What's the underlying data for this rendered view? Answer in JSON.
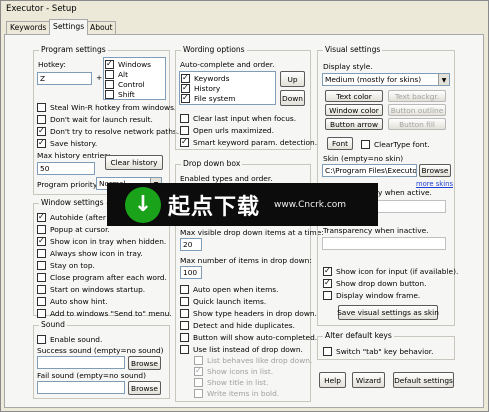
{
  "window": {
    "title": "Executor - Setup"
  },
  "tabs": [
    {
      "label": "Keywords"
    },
    {
      "label": "Settings"
    },
    {
      "label": "About"
    }
  ],
  "program_settings": {
    "title": "Program settings",
    "hotkey_label": "Hotkey:",
    "hotkey_value": "Z",
    "plus": "+",
    "modifiers": [
      {
        "label": "Windows",
        "checked": true
      },
      {
        "label": "Alt",
        "checked": false
      },
      {
        "label": "Control",
        "checked": false
      },
      {
        "label": "Shift",
        "checked": false
      }
    ],
    "options": [
      {
        "label": "Steal Win-R hotkey from windows.",
        "checked": false
      },
      {
        "label": "Don't wait for launch result.",
        "checked": false
      },
      {
        "label": "Don't try to resolve network paths.",
        "checked": true
      },
      {
        "label": "Save history.",
        "checked": true
      }
    ],
    "max_history_label": "Max history entries:",
    "max_history_value": "50",
    "clear_history": "Clear history",
    "priority_label": "Program priority",
    "priority_value": "Normal"
  },
  "window_settings": {
    "title": "Window settings",
    "options": [
      {
        "label": "Autohide (after word a",
        "checked": true
      },
      {
        "label": "Popup at cursor.",
        "checked": false
      },
      {
        "label": "Show icon in tray when hidden.",
        "checked": true
      },
      {
        "label": "Always show icon in tray.",
        "checked": false
      },
      {
        "label": "Stay on top.",
        "checked": false
      },
      {
        "label": "Close program after each word.",
        "checked": false
      },
      {
        "label": "Start on windows startup.",
        "checked": false
      },
      {
        "label": "Auto show hint.",
        "checked": false
      },
      {
        "label": "Add to windows \"Send to\" menu.",
        "checked": false
      }
    ]
  },
  "sound": {
    "title": "Sound",
    "enable_label": "Enable sound.",
    "success_label": "Success sound (empty=no sound)",
    "fail_label": "Fail sound (empty=no sound)",
    "browse": "Browse"
  },
  "wording": {
    "title": "Wording options",
    "autocomplete_label": "Auto-complete and order.",
    "items": [
      {
        "label": "Keywords",
        "checked": true
      },
      {
        "label": "History",
        "checked": true
      },
      {
        "label": "File system",
        "checked": true
      }
    ],
    "up": "Up",
    "down": "Down",
    "options": [
      {
        "label": "Clear last input when focus.",
        "checked": false
      },
      {
        "label": "Open urls maximized.",
        "checked": false
      },
      {
        "label": "Smart keyword param. detection.",
        "checked": true
      }
    ]
  },
  "dropdown": {
    "title": "Drop down box",
    "enabled_label": "Enabled types and order.",
    "max_visible_label": "Max visible drop down items at a time:",
    "max_visible_value": "20",
    "max_items_label": "Max number of items in drop down:",
    "max_items_value": "100",
    "options": [
      {
        "label": "Auto open when items.",
        "checked": false,
        "dim": false
      },
      {
        "label": "Quick launch items.",
        "checked": false,
        "dim": false
      },
      {
        "label": "Show type headers in drop down.",
        "checked": false,
        "dim": false
      },
      {
        "label": "Detect and hide duplicates.",
        "checked": false,
        "dim": false
      },
      {
        "label": "Button will show auto-completed.",
        "checked": false,
        "dim": false
      },
      {
        "label": "Use list instead of drop down.",
        "checked": false,
        "dim": false
      },
      {
        "label": "List behaves like drop down.",
        "checked": false,
        "dim": true
      },
      {
        "label": "Show icons in list.",
        "checked": true,
        "dim": true
      },
      {
        "label": "Show title in list.",
        "checked": false,
        "dim": true
      },
      {
        "label": "Write items in bold.",
        "checked": false,
        "dim": true
      }
    ]
  },
  "visual": {
    "title": "Visual settings",
    "display_style_label": "Display style.",
    "display_style_value": "Medium (mostly for skins)",
    "buttons": [
      {
        "label": "Text color",
        "enabled": true
      },
      {
        "label": "Text backgr.",
        "enabled": false
      },
      {
        "label": "Window color",
        "enabled": true
      },
      {
        "label": "Button outline",
        "enabled": false
      },
      {
        "label": "Button arrow",
        "enabled": true
      },
      {
        "label": "Button fill",
        "enabled": false
      }
    ],
    "font": "Font",
    "cleartype_label": "ClearType font.",
    "skin_label": "Skin (empty=no skin)",
    "skin_value": "C:\\Program Files\\Executo",
    "browse": "Browse",
    "more_skins": "more skins",
    "transparency_active_label": "y when active.",
    "transparency_inactive_label": "Transparency when inactive.",
    "options": [
      {
        "label": "Show icon for input (if available).",
        "checked": true
      },
      {
        "label": "Show drop down button.",
        "checked": true
      },
      {
        "label": "Display window frame.",
        "checked": false
      }
    ],
    "save_skin": "Save visual settings as skin"
  },
  "alter_keys": {
    "title": "Alter default keys",
    "switch_label": "Switch \"tab\" key behavior."
  },
  "footer": {
    "help": "Help",
    "wizard": "Wizard",
    "default_settings": "Default settings"
  },
  "overlay": {
    "title": "起点下载",
    "url": "www.Cncrk.com",
    "icon": "download-arrow-icon",
    "color": "#1aa31a"
  }
}
